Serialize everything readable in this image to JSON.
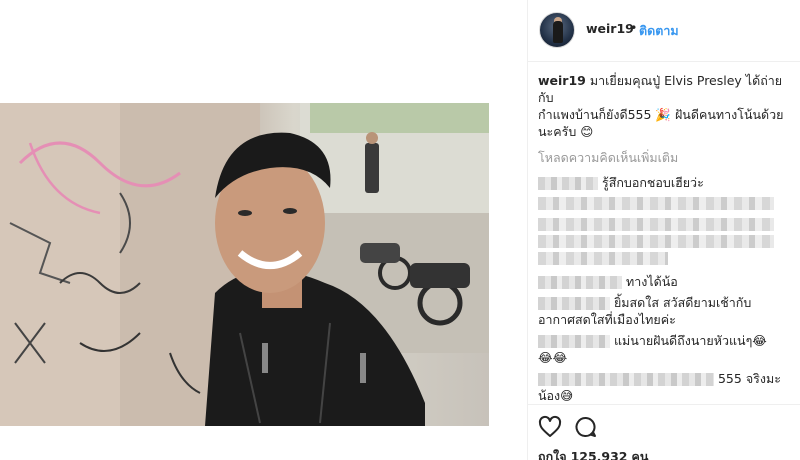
{
  "post": {
    "username": "weir19",
    "separator": "•",
    "follow_label": "ติดตาม"
  },
  "caption": {
    "username": "weir19",
    "line1": "มาเยี่ยมคุณปู่ Elvis Presley ได้ถ่ายกับ",
    "line2": "กำแพงบ้านก็ยังดี555 🎉 ฝันดีคนทางโน้นด้วย",
    "line3": "นะครับ 😊"
  },
  "load_more": "โหลดความคิดเห็นเพิ่มเติม",
  "comments": [
    {
      "text": "รู้สึกบอกชอบเฮียว่ะ"
    },
    {
      "text": "ทางได้น้อ"
    },
    {
      "text": "ยิ้มสดใส สวัสดียามเช้ากับ"
    },
    {
      "text": "อากาศสดใสที่เมืองไทยค่ะ"
    },
    {
      "text": "แม่นายฝันดีถึงนายหัวแน่ๆ😂"
    },
    {
      "text": "😂😂"
    },
    {
      "text": "555 จริงมะ"
    },
    {
      "text": "น้อง😅"
    }
  ],
  "actions": {
    "like_icon": "heart-icon",
    "comment_icon": "comment-icon",
    "likes_label": "ถูกใจ",
    "likes_count": "125,932",
    "likes_unit": "คน"
  },
  "colors": {
    "link_blue": "#3897f0",
    "muted_gray": "#999999",
    "text": "#262626"
  }
}
